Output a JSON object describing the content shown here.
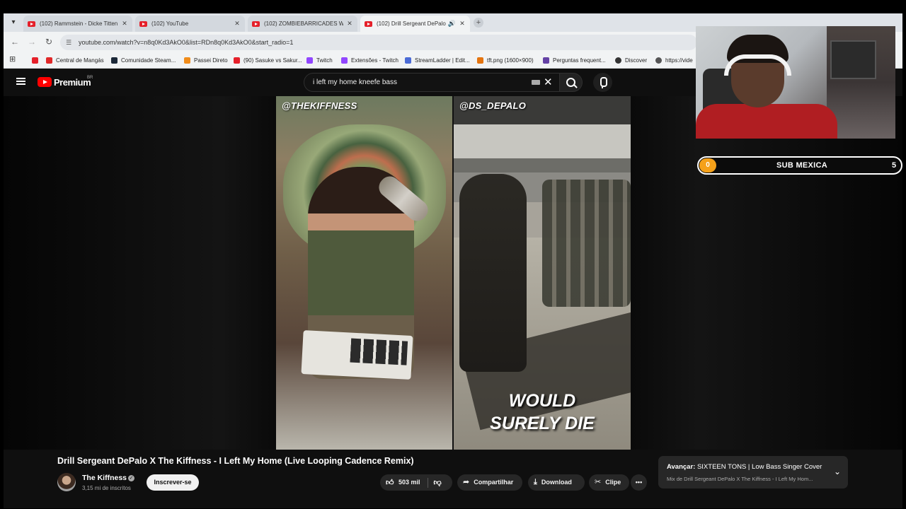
{
  "browser": {
    "tabs": [
      {
        "title": "(102) Rammstein - Dicke Titten"
      },
      {
        "title": "(102) YouTube"
      },
      {
        "title": "(102) ZOMBIEBARRICADES Wa"
      },
      {
        "title": "(102) Drill Sergeant DePalo",
        "active": true,
        "audio": true
      }
    ],
    "url": "youtube.com/watch?v=n8q0Kd3AkO0&list=RDn8q0Kd3AkO0&start_radio=1",
    "bookmarks": [
      {
        "label": "Central de Mangás",
        "color": "#e02828"
      },
      {
        "label": "Comunidade Steam...",
        "color": "#1b2838"
      },
      {
        "label": "Passei Direto",
        "color": "#f08c1a"
      },
      {
        "label": "(90) Sasuke vs Sakur...",
        "color": "#e5202a"
      },
      {
        "label": "Twitch",
        "color": "#9146ff"
      },
      {
        "label": "Extensões - Twitch",
        "color": "#9146ff"
      },
      {
        "label": "StreamLadder | Edit...",
        "color": "#4b6bd6"
      },
      {
        "label": "tft.png (1600×900)",
        "color": "#e4740f"
      },
      {
        "label": "Perguntas frequent...",
        "color": "#6441a5"
      },
      {
        "label": "Discover",
        "color": "#333333"
      },
      {
        "label": "https://vide",
        "color": "#555555"
      }
    ]
  },
  "youtube": {
    "logo_text": "Premium",
    "region": "BR",
    "search_value": "i left my home kneefe bass"
  },
  "video": {
    "left_handle": "@THEKIFFNESS",
    "right_handle": "@DS_DEPALO",
    "caption_line1": "WOULD",
    "caption_line2": "SURELY DIE",
    "title": "Drill Sergeant DePalo X The Kiffness - I Left My Home (Live Looping Cadence Remix)",
    "channel": "The Kiffness",
    "subscribers": "3,15 mi de inscritos",
    "subscribe_label": "Inscrever-se",
    "likes": "503 mil",
    "share_label": "Compartilhar",
    "download_label": "Download",
    "clip_label": "Clipe"
  },
  "up_next": {
    "prefix": "Avançar:",
    "title": "SIXTEEN TONS | Low Bass Singer Cover",
    "playlist": "Mix de Drill Sergeant DePalo X The Kiffness - I Left My Hom..."
  },
  "overlay": {
    "sub_left": "0",
    "sub_title": "SUB MEXICA",
    "sub_right": "5"
  },
  "colors": {
    "youtube_red": "#ff0000",
    "counter_orange": "#f5a11a",
    "background": "#0f0f0f"
  }
}
